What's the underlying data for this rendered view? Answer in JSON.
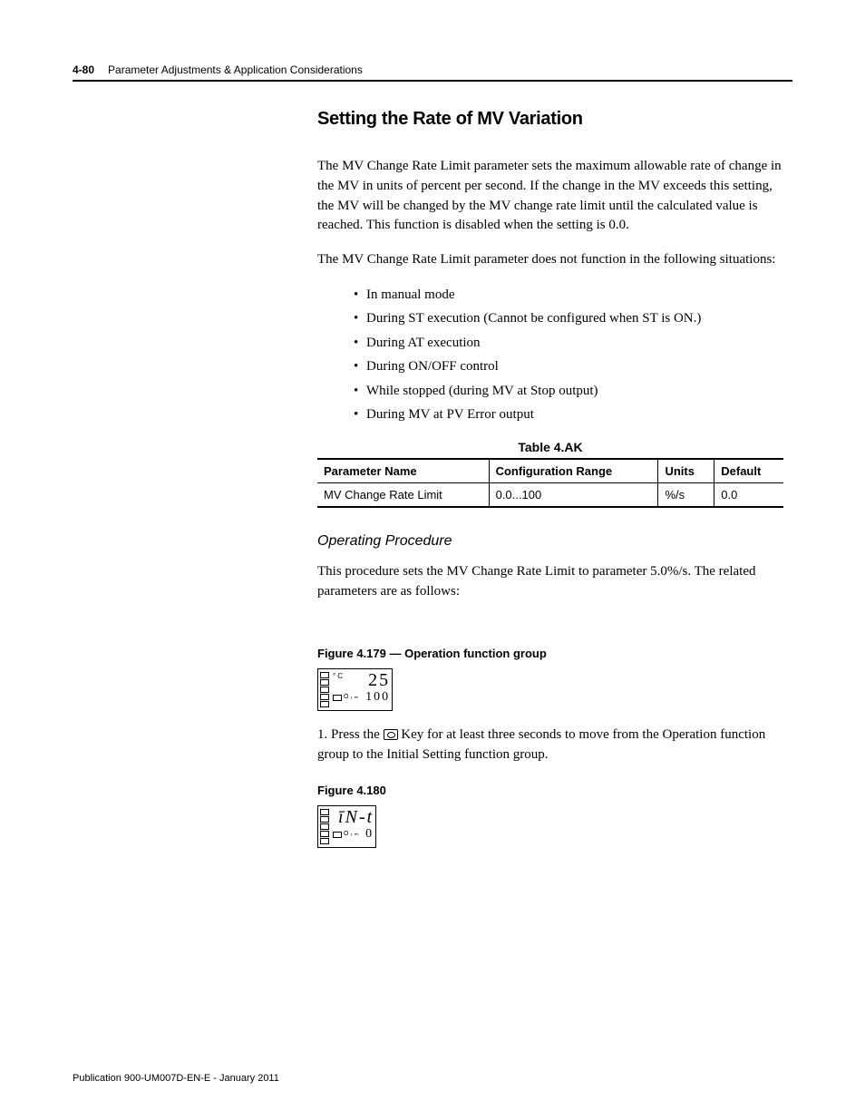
{
  "header": {
    "page_number": "4-80",
    "chapter_title": "Parameter Adjustments & Application Considerations"
  },
  "section_title": "Setting the Rate of MV Variation",
  "paragraph1": "The MV Change Rate Limit parameter sets the maximum allowable rate of change in the MV in units of percent per second. If the change in the MV exceeds this setting, the MV will be changed by the MV change rate limit until the calculated value is reached. This function is disabled when the setting is 0.0.",
  "paragraph2": "The MV Change Rate Limit parameter does not function in the following situations:",
  "bullets": [
    "In manual mode",
    "During ST execution (Cannot be configured when ST is ON.)",
    "During AT execution",
    "During ON/OFF control",
    "While stopped (during MV at Stop output)",
    "During MV at PV Error output"
  ],
  "table_caption": "Table 4.AK",
  "table": {
    "headers": [
      "Parameter Name",
      "Configuration Range",
      "Units",
      "Default"
    ],
    "rows": [
      [
        "MV Change Rate Limit",
        "0.0...100",
        "%/s",
        "0.0"
      ]
    ]
  },
  "subheading": "Operating Procedure",
  "paragraph3": "This procedure sets the MV Change Rate Limit to parameter 5.0%/s. The related parameters are as follows:",
  "figure1_caption": "Figure 4.179 — Operation function group",
  "display1": {
    "deg_label": "°C",
    "top_value": "25",
    "o_label": "O₁ₘ",
    "bot_value": "100"
  },
  "step1_prefix": "1. Press the ",
  "step1_suffix": " Key for at least three seconds to move from the Operation function group to the Initial Setting function group.",
  "figure2_caption": "Figure 4.180",
  "display2": {
    "top_value": "īN-t",
    "o_label": "O₁ₘ",
    "bot_value": "0"
  },
  "footer": "Publication 900-UM007D-EN-E - January 2011"
}
